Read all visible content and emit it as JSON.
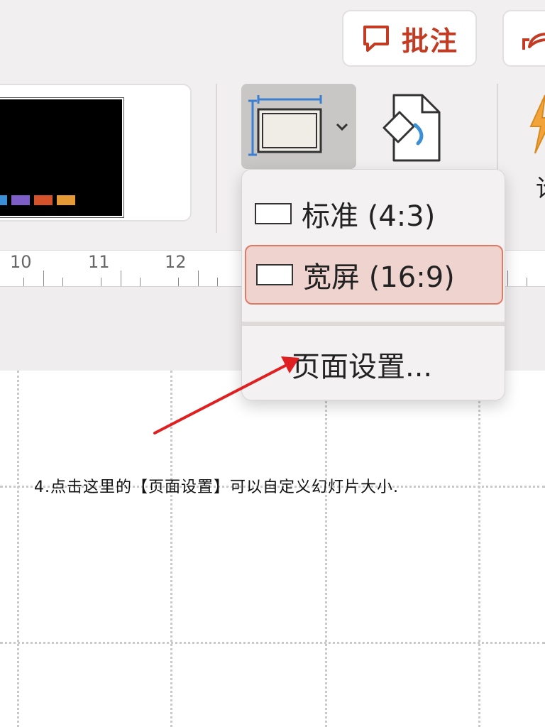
{
  "header": {
    "comments_label": "批注"
  },
  "ribbon": {
    "partial_label": "论",
    "thumbnail_bar_colors": [
      "#3a8fd6",
      "#7d5ec8",
      "#d6522a",
      "#e69a35"
    ]
  },
  "ruler": {
    "numbers": [
      "10",
      "11",
      "12"
    ]
  },
  "slide_size_menu": {
    "items": [
      {
        "label": "标准 (4:3)",
        "selected": false
      },
      {
        "label": "宽屏 (16:9)",
        "selected": true
      },
      {
        "label": "页面设置..."
      }
    ]
  },
  "annotation": {
    "text": "4.点击这里的【页面设置】可以自定义幻灯片大小."
  },
  "colors": {
    "accent": "#c43b24",
    "selection_fill": "#efd3ce",
    "selection_border": "#df7a66",
    "arrow": "#e02020"
  }
}
